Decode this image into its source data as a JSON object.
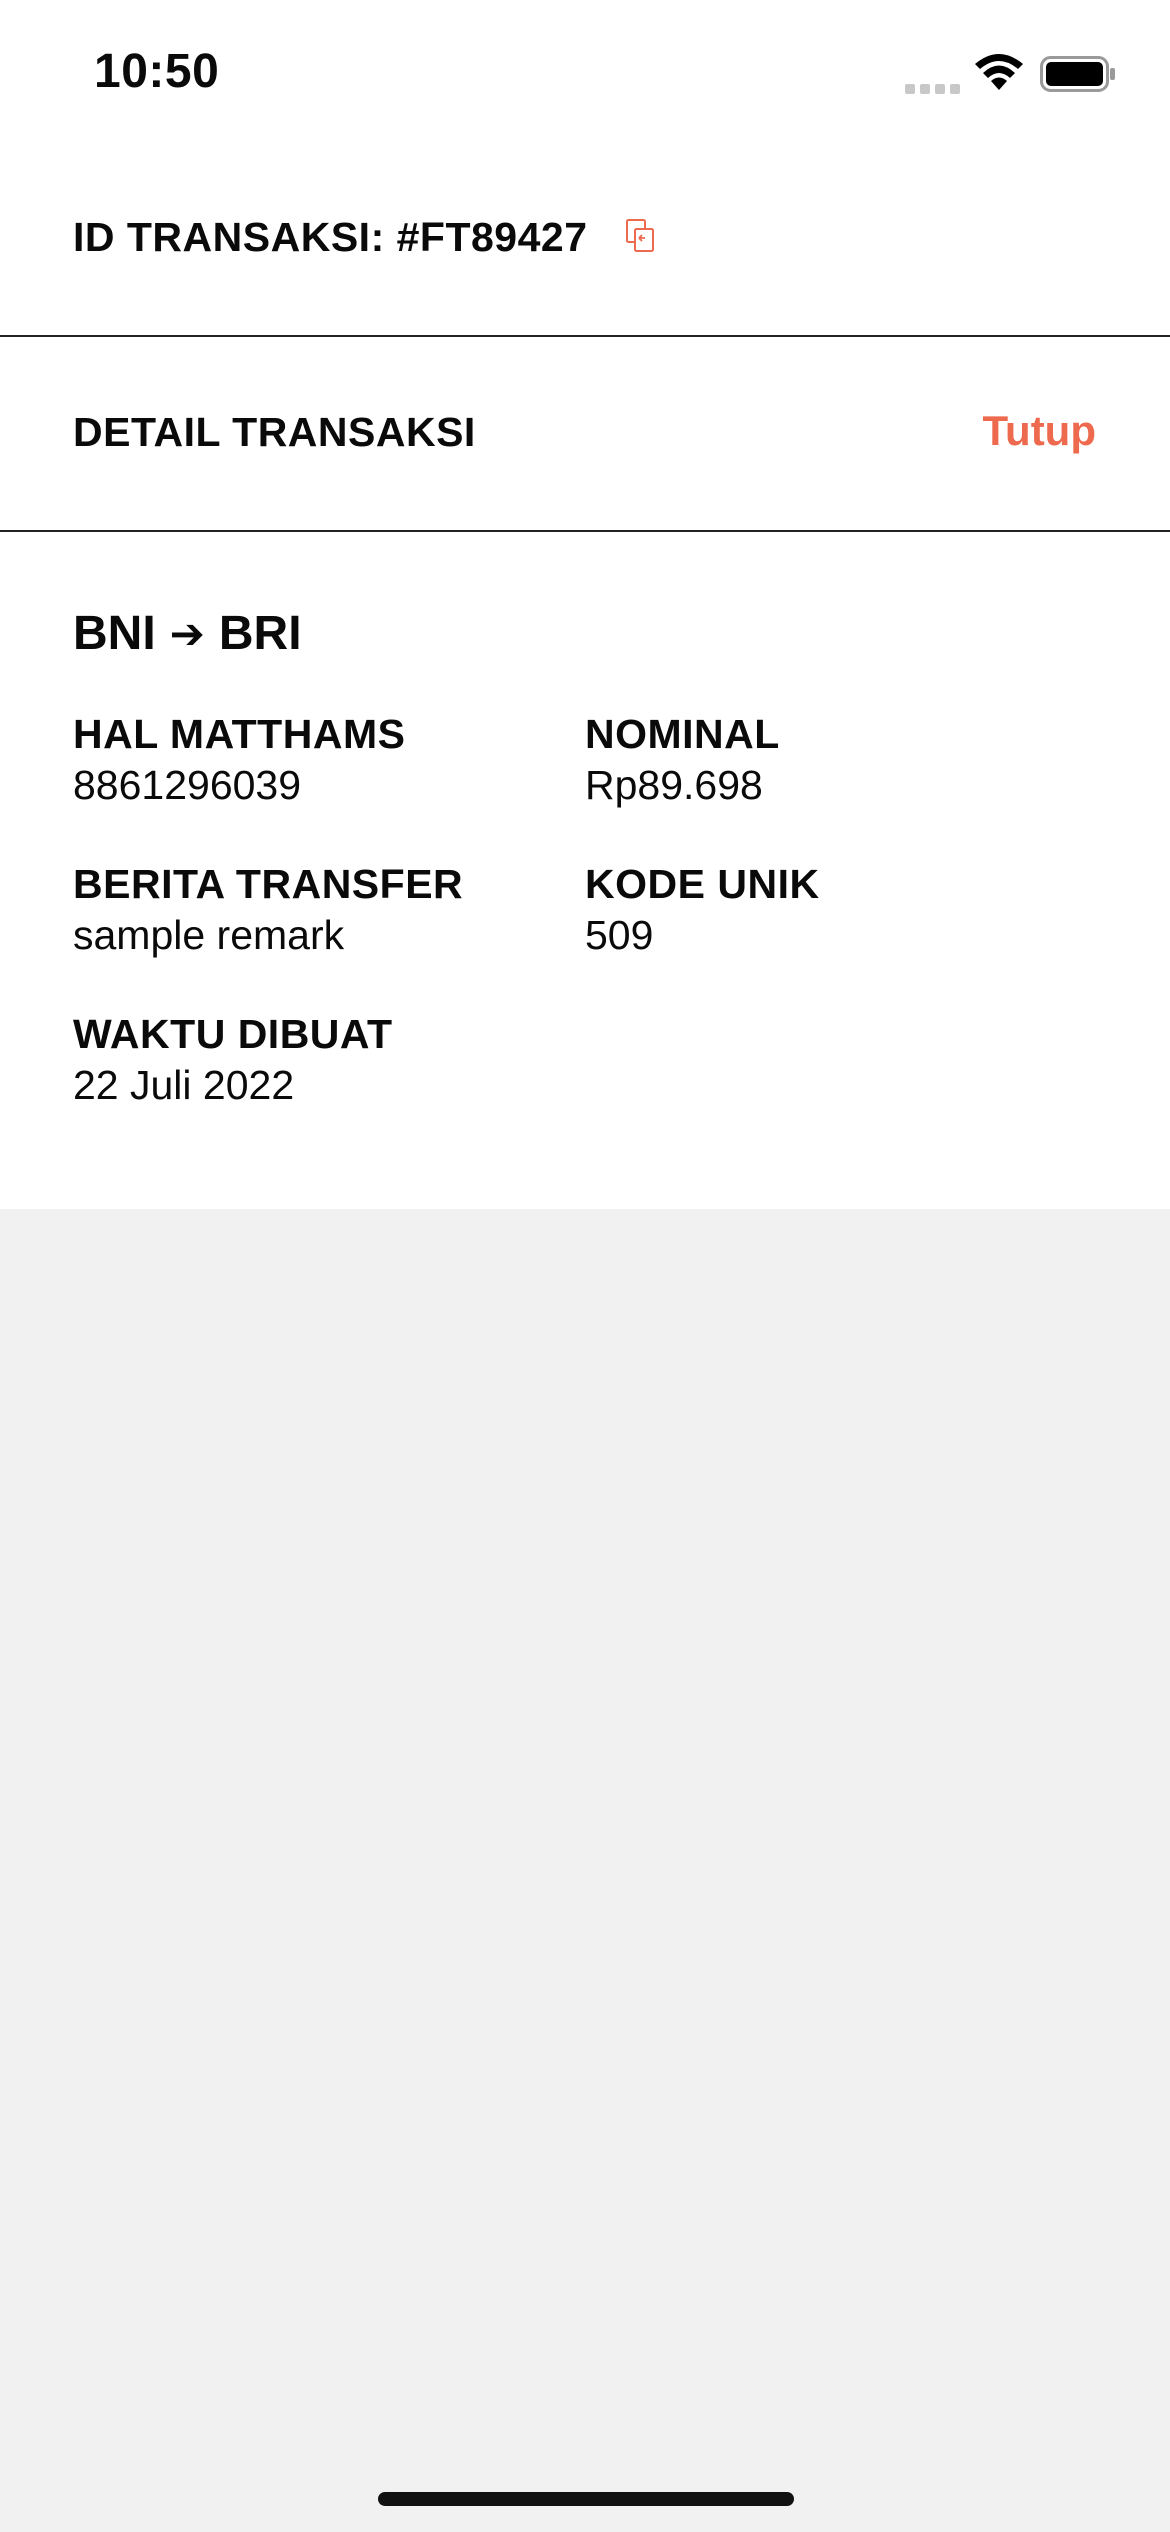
{
  "status_bar": {
    "time": "10:50"
  },
  "header": {
    "transaction_id_label": "ID TRANSAKSI: #FT89427",
    "copy_icon": "copy-icon"
  },
  "detail_header": {
    "title": "DETAIL TRANSAKSI",
    "close_label": "Tutup"
  },
  "route": {
    "from": "BNI",
    "arrow": "➔",
    "to": "BRI"
  },
  "fields": {
    "name_label": "HAL MATTHAMS",
    "name_value": "8861296039",
    "nominal_label": "NOMINAL",
    "nominal_value": "Rp89.698",
    "remark_label": "BERITA TRANSFER",
    "remark_value": "sample remark",
    "unique_code_label": "KODE UNIK",
    "unique_code_value": "509",
    "created_label": "WAKTU DIBUAT",
    "created_value": "22 Juli 2022"
  },
  "colors": {
    "accent": "#ee6a4f",
    "background": "#f1f1f1",
    "card": "#ffffff",
    "text": "#0a0a0a"
  }
}
